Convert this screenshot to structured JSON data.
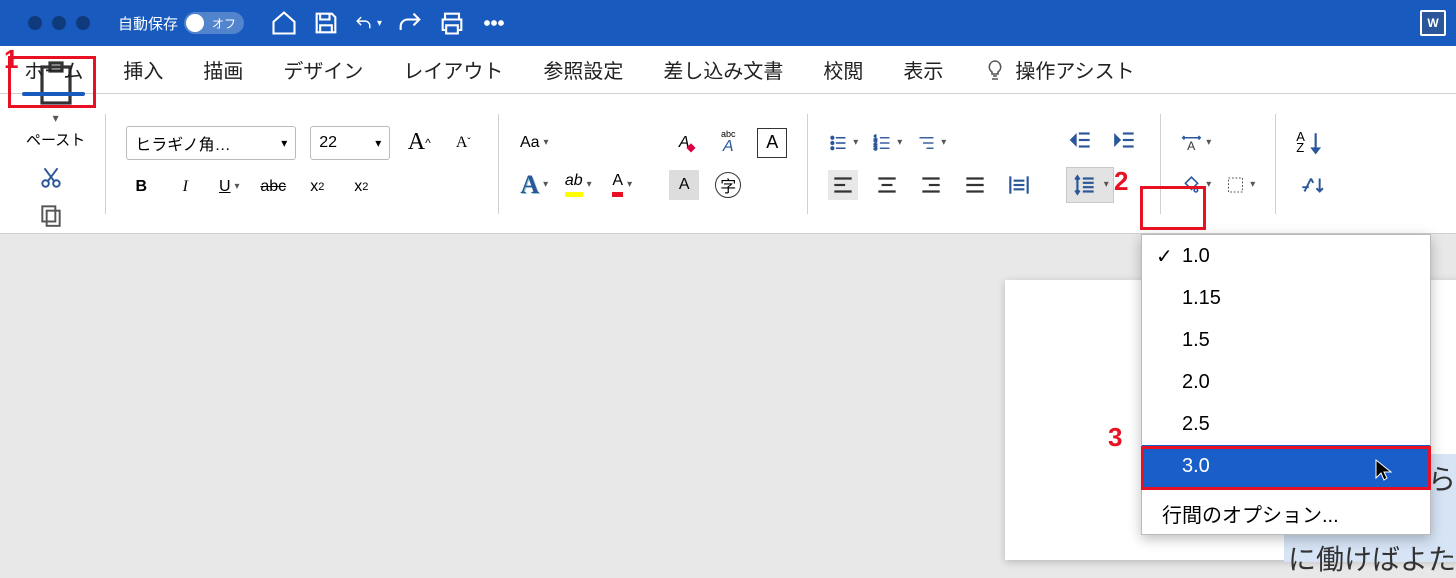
{
  "titlebar": {
    "autosave_label": "自動保存",
    "autosave_off_label": "オフ"
  },
  "tabs": {
    "home": "ホーム",
    "insert": "挿入",
    "draw": "描画",
    "design": "デザイン",
    "layout": "レイアウト",
    "references": "参照設定",
    "mailings": "差し込み文書",
    "review": "校閲",
    "view": "表示",
    "assist": "操作アシスト"
  },
  "ribbon": {
    "paste_label": "ペースト",
    "font_name": "ヒラギノ角…",
    "font_size": "22",
    "bold": "B",
    "italic": "I",
    "underline": "U",
    "strike": "abc",
    "sub": "x",
    "sup": "x",
    "text_effect": "A",
    "highlight": "ab",
    "font_color": "A",
    "shading": "A",
    "enclose": "字",
    "increase_A": "A",
    "decrease_A": "A",
    "aa": "Aa",
    "clear_format": "A",
    "ruby_abc": "abc",
    "ruby_A": "A",
    "box_A": "A",
    "sort": "A",
    "sort_Z": "Z"
  },
  "line_spacing_menu": {
    "items": [
      "1.0",
      "1.15",
      "1.5",
      "2.0",
      "2.5",
      "3.0"
    ],
    "checked_index": 0,
    "highlight_index": 5,
    "options_label": "行間のオプション..."
  },
  "annotations": {
    "n1": "1",
    "n2": "2",
    "n3": "3"
  },
  "peek_text_1": "ら",
  "peek_text_2": "に働けばよた"
}
